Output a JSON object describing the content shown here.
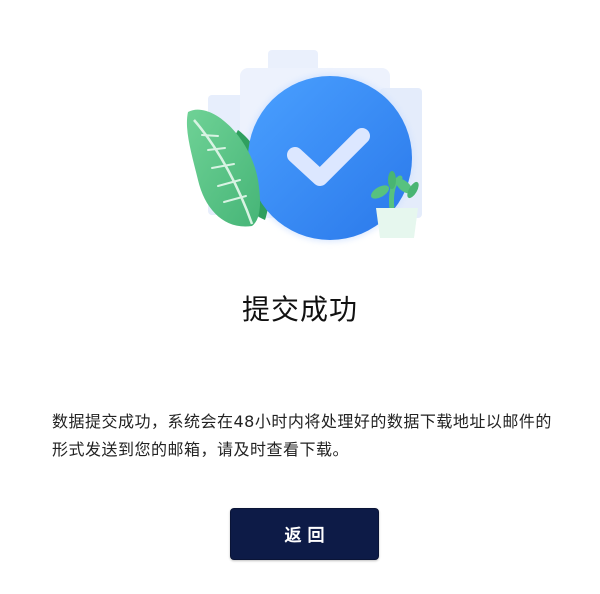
{
  "result": {
    "title": "提交成功",
    "message": "数据提交成功，系统会在48小时内将处理好的数据下载地址以邮件的形式发送到您的邮箱，请及时查看下载。"
  },
  "actions": {
    "back_label": "返回"
  },
  "illustration": {
    "icon": "success-check-icon",
    "colors": {
      "circle": "#3a8cf5",
      "leaf": "#5cc68a",
      "pot": "#e6f7ee",
      "background_shapes": "#e4ecfb"
    }
  },
  "colors": {
    "button_bg": "#0d1b47",
    "text": "#222222"
  }
}
